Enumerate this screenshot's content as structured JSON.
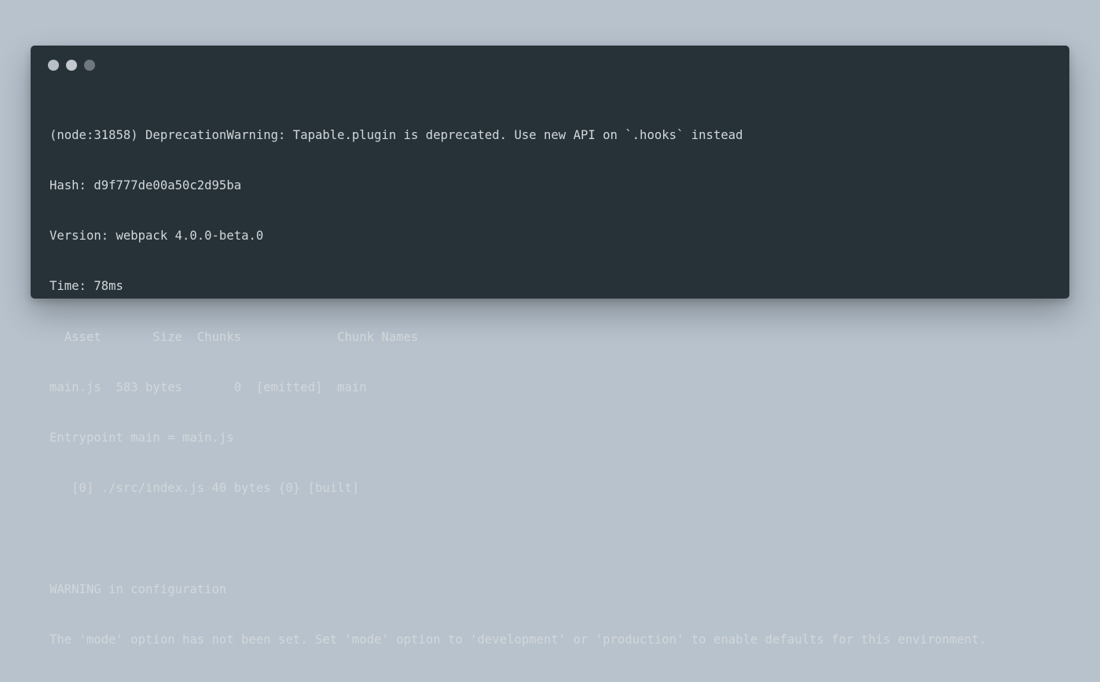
{
  "window": {
    "controls": [
      "close",
      "minimize",
      "maximize"
    ],
    "colors": {
      "background": "#b7c2cd",
      "terminal": "#263238",
      "text": "#d2d7da"
    }
  },
  "terminal": {
    "lines": [
      "(node:31858) DeprecationWarning: Tapable.plugin is deprecated. Use new API on `.hooks` instead",
      "Hash: d9f777de00a50c2d95ba",
      "Version: webpack 4.0.0-beta.0",
      "Time: 78ms",
      "  Asset       Size  Chunks             Chunk Names",
      "main.js  583 bytes       0  [emitted]  main",
      "Entrypoint main = main.js",
      "   [0] ./src/index.js 40 bytes {0} [built]",
      "",
      "WARNING in configuration",
      "The 'mode' option has not been set. Set 'mode' option to 'development' or 'production' to enable defaults for this environment."
    ]
  }
}
